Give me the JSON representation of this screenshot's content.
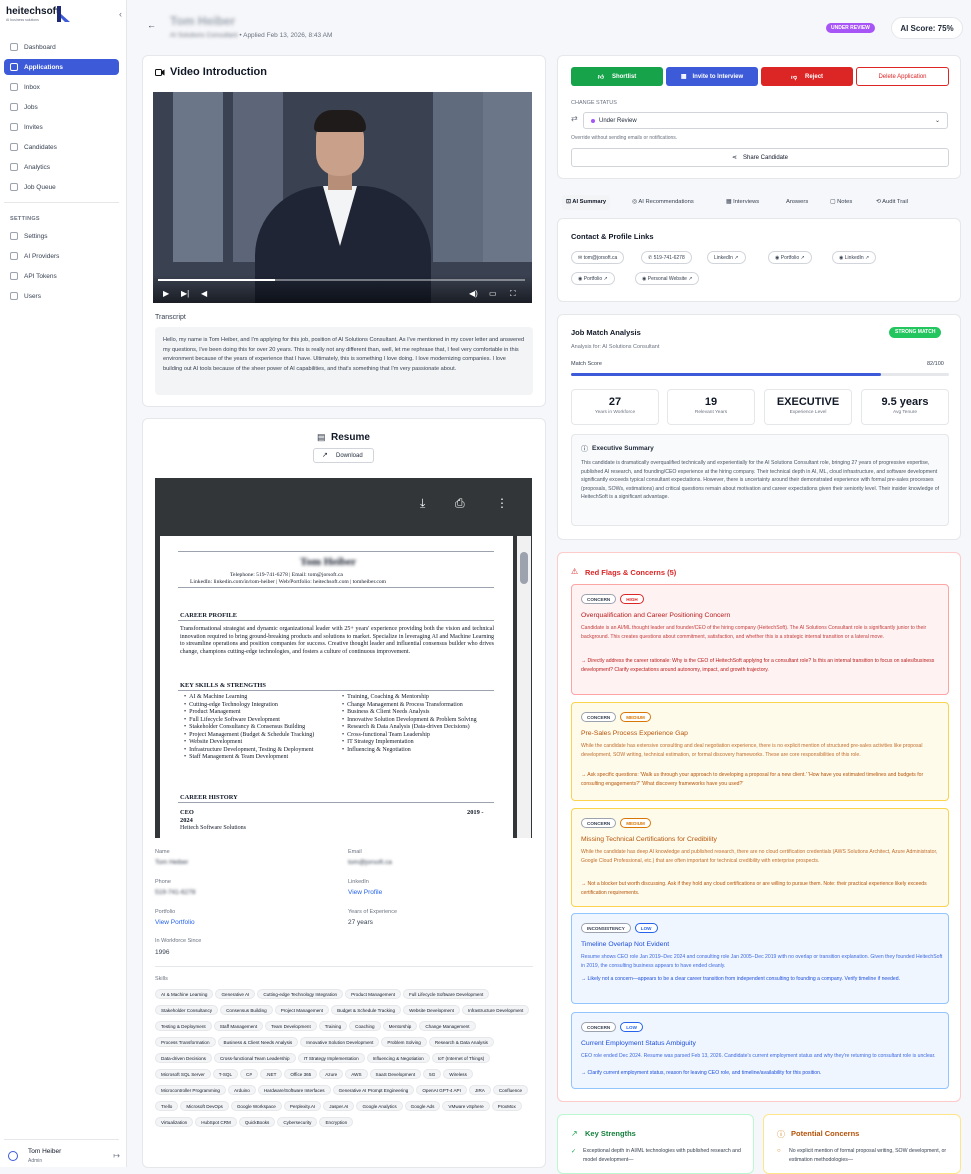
{
  "sidebar": {
    "brand": "heitechsoft",
    "tagline": "AI business solutions",
    "nav": [
      "Dashboard",
      "Applications",
      "Inbox",
      "Jobs",
      "Invites",
      "Candidates",
      "Analytics",
      "Job Queue"
    ],
    "settings_label": "SETTINGS",
    "settings_nav": [
      "Settings",
      "AI Providers",
      "API Tokens",
      "Users"
    ],
    "user_name": "Tom Heiber",
    "user_role": "Admin"
  },
  "header": {
    "name": "Tom Heiber",
    "role": "AI Solutions Consultant",
    "applied": " • Applied Feb 13, 2026, 8:43 AM",
    "status": "UNDER REVIEW",
    "score": "AI Score: 75%"
  },
  "video": {
    "title": "Video Introduction",
    "transcript_label": "Transcript",
    "transcript": "Hello, my name is Tom Heiber, and I'm applying for this job, position of AI Solutions Consultant. As I've mentioned in my cover letter and answered my questions, I've been doing this for over 20 years. This is really not any different than, well, let me rephrase that, I feel very comfortable in this environment because of the years of experience that I have. Ultimately, this is something I love doing. I love modernizing companies. I love building out AI tools because of the sheer power of AI capabilities, and that's something that I'm very passionate about."
  },
  "resume": {
    "title": "Resume",
    "download": "Download",
    "doc_name": "Tom Heiber",
    "contact": "Telephone: 519-741-6278 | Email: tom@jorsoft.ca",
    "links": "LinkedIn: linkedin.com/in/tom-heiber | Web/Portfolio: heitechsoft.com | tomheiber.com",
    "career_profile_h": "CAREER PROFILE",
    "career_profile": "Transformational strategist and dynamic organizational leader with 25+ years' experience providing both the vision and technical innovation required to bring ground-breaking products and solutions to market. Specialize in leveraging AI and Machine Learning to streamline operations and position companies for success. Creative thought leader and influential consensus builder who drives change, champions cutting-edge technologies, and fosters a culture of continuous improvement.",
    "skills_h": "KEY SKILLS & STRENGTHS",
    "skills_left": [
      "AI & Machine Learning",
      "Cutting-edge Technology Integration",
      "Product Management",
      "Full Lifecycle Software Development",
      "Stakeholder Consultancy & Consensus Building",
      "Project Management (Budget & Schedule Tracking)",
      "Website Development",
      "Infrastructure Development, Testing & Deployment",
      "Staff Management & Team Development"
    ],
    "skills_right": [
      "Training, Coaching & Mentorship",
      "Change Management & Process Transformation",
      "Business & Client Needs Analysis",
      "Innovative Solution Development & Problem Solving",
      "Research & Data Analysis (Data-driven Decisions)",
      "Cross-functional Team Leadership",
      "IT Strategy Implementation",
      "Influencing & Negotiation"
    ],
    "history_h": "CAREER HISTORY",
    "ceo": "CEO",
    "ceo_dates": "2019 -",
    "ceo_year": "2024",
    "company": "Heitech Software Solutions"
  },
  "details": {
    "name_l": "Name",
    "name_v": "Tom Heiber",
    "email_l": "Email",
    "email_v": "tom@jorsoft.ca",
    "phone_l": "Phone",
    "phone_v": "519-741-6278",
    "linkedin_l": "LinkedIn",
    "linkedin_v": "View Profile",
    "portfolio_l": "Portfolio",
    "portfolio_v": "View Portfolio",
    "yoe_l": "Years of Experience",
    "yoe_v": "27 years",
    "iwf_l": "In Workforce Since",
    "iwf_v": "1996",
    "skills_l": "Skills",
    "skills": [
      "AI & Machine Learning",
      "Generative AI",
      "Cutting-edge Technology Integration",
      "Product Management",
      "Full Lifecycle Software Development",
      "Stakeholder Consultancy",
      "Consensus Building",
      "Project Management",
      "Budget & Schedule Tracking",
      "Website Development",
      "Infrastructure Development",
      "Testing & Deployment",
      "Staff Management",
      "Team Development",
      "Training",
      "Coaching",
      "Mentorship",
      "Change Management",
      "Process Transformation",
      "Business & Client Needs Analysis",
      "Innovative Solution Development",
      "Problem Solving",
      "Research & Data Analysis",
      "Data-driven Decisions",
      "Cross-functional Team Leadership",
      "IT Strategy Implementation",
      "Influencing & Negotiation",
      "IoT (Internet of Things)",
      "Microsoft SQL Server",
      "T-SQL",
      "C#",
      ".NET",
      "Office 365",
      "Azure",
      "AWS",
      "SaaS Development",
      "5G",
      "Wireless",
      "Microcontroller Programming",
      "Arduino",
      "Hardware/Software Interfaces",
      "Generative AI Prompt Engineering",
      "OpenAI GPT-4 API",
      "JIRA",
      "Confluence",
      "Trello",
      "Microsoft DevOps",
      "Google Workspace",
      "Perplexity.AI",
      "Jasper.AI",
      "Google Analytics",
      "Google Ads",
      "VMware vSphere",
      "ProxMox",
      "Virtualization",
      "HubSpot CRM",
      "QuickBooks",
      "Cybersecurity",
      "Encryption"
    ]
  },
  "actions": {
    "shortlist": "Shortlist",
    "invite": "Invite to Interview",
    "reject": "Reject",
    "delete": "Delete Application",
    "change_status": "CHANGE STATUS",
    "status_value": "Under Review",
    "override": "Override without sending emails or notifications.",
    "share": "Share Candidate"
  },
  "tabs": [
    "AI Summary",
    "AI Recommendations",
    "Interviews",
    "Answers",
    "Notes",
    "Audit Trail"
  ],
  "contact": {
    "title": "Contact & Profile Links",
    "items": [
      "tom@jorsoft.ca",
      "519-741-6278",
      "LinkedIn",
      "Portfolio",
      "LinkedIn",
      "Portfolio",
      "Personal Website"
    ]
  },
  "match": {
    "title": "Job Match Analysis",
    "badge": "STRONG MATCH",
    "for": "Analysis for: AI Solutions Consultant",
    "score_label": "Match Score",
    "score": "82/100",
    "score_value": 82,
    "stats": [
      {
        "v": "27",
        "k": "Years in Workforce"
      },
      {
        "v": "19",
        "k": "Relevant Years"
      },
      {
        "v": "EXECUTIVE",
        "k": "Experience Level"
      },
      {
        "v": "9.5 years",
        "k": "Avg Tenure"
      }
    ],
    "exec_title": "Executive Summary",
    "exec": "This candidate is dramatically overqualified technically and experientially for the AI Solutions Consultant role, bringing 27 years of progressive expertise, published AI research, and founding/CEO experience at the hiring company. Their technical depth in AI, ML, cloud infrastructure, and software development significantly exceeds typical consultant expectations. However, there is uncertainty around their demonstrated experience with formal pre-sales processes (proposals, SOWs, estimations) and critical questions remain about motivation and career expectations given their seniority level. Their insider knowledge of HeitechSoft is a significant advantage."
  },
  "flags": {
    "title": "Red Flags & Concerns (5)",
    "items": [
      {
        "type": "CONCERN",
        "level": "HIGH",
        "title": "Overqualification and Career Positioning Concern",
        "body": "Candidate is an AI/ML thought leader and founder/CEO of the hiring company (HeitechSoft). The AI Solutions Consultant role is significantly junior to their background. This creates questions about commitment, satisfaction, and whether this is a strategic internal transition or a lateral move.",
        "action": "→ Directly address the career rationale: Why is the CEO of HeitechSoft applying for a consultant role? Is this an internal transition to focus on sales/business development? Clarify expectations around autonomy, impact, and growth trajectory."
      },
      {
        "type": "CONCERN",
        "level": "MEDIUM",
        "title": "Pre-Sales Process Experience Gap",
        "body": "While the candidate has extensive consulting and deal negotiation experience, there is no explicit mention of structured pre-sales activities like proposal development, SOW writing, technical estimation, or formal discovery frameworks. These are core responsibilities of this role.",
        "action": "→ Ask specific questions: 'Walk us through your approach to developing a proposal for a new client.' 'How have you estimated timelines and budgets for consulting engagements?' 'What discovery frameworks have you used?'"
      },
      {
        "type": "CONCERN",
        "level": "MEDIUM",
        "title": "Missing Technical Certifications for Credibility",
        "body": "While the candidate has deep AI knowledge and published research, there are no cloud certification credentials (AWS Solutions Architect, Azure Administrator, Google Cloud Professional, etc.) that are often important for technical credibility with enterprise prospects.",
        "action": "→ Not a blocker but worth discussing. Ask if they hold any cloud certifications or are willing to pursue them. Note: their practical experience likely exceeds certification requirements."
      },
      {
        "type": "INCONSISTENCY",
        "level": "LOW",
        "title": "Timeline Overlap Not Evident",
        "body": "Resume shows CEO role Jan 2019–Dec 2024 and consulting role Jan 2005–Dec 2019 with no overlap or transition explanation. Given they founded HeitechSoft in 2019, the consulting business appears to have ended cleanly.",
        "action": "→ Likely not a concern—appears to be a clear career transition from independent consulting to founding a company. Verify timeline if needed."
      },
      {
        "type": "CONCERN",
        "level": "LOW",
        "title": "Current Employment Status Ambiguity",
        "body": "CEO role ended Dec 2024. Resume was parsed Feb 13, 2026. Candidate's current employment status and why they're returning to consultant role is unclear.",
        "action": "→ Clarify current employment status, reason for leaving CEO role, and timeline/availability for this position."
      }
    ]
  },
  "strengths": {
    "title": "Key Strengths",
    "first": "Exceptional depth in AI/ML technologies with published research and model development—"
  },
  "potential": {
    "title": "Potential Concerns",
    "first": "No explicit mention of formal proposal writing, SOW development, or estimation methodologies—"
  },
  "colors": {
    "primary": "#3d5ad9",
    "shortlist": "#16a34a",
    "reject": "#dc2626",
    "purple": "#a855f7"
  }
}
